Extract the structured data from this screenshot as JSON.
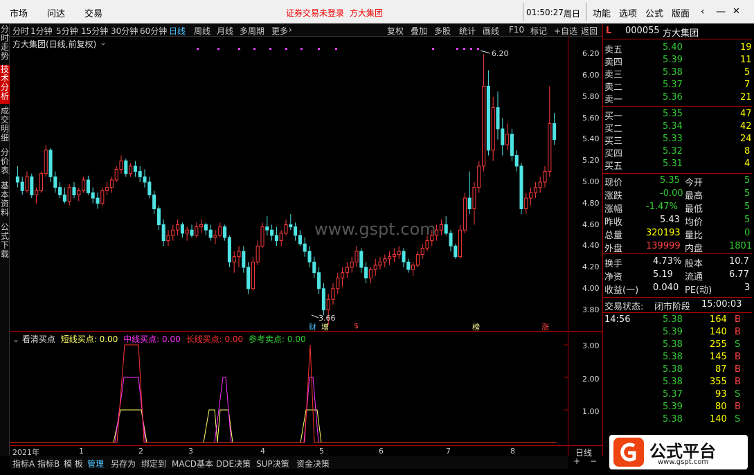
{
  "topbar": {
    "menu": [
      "市场",
      "问达",
      "交易"
    ],
    "warning": "证券交易未登录",
    "broker": "方大集团",
    "time": "01:50:27",
    "weekday": "周日",
    "right_menu": [
      "功能",
      "选项",
      "公式",
      "版面"
    ]
  },
  "toolbar": {
    "periods": [
      "分时",
      "1分钟",
      "5分钟",
      "15分钟",
      "30分钟",
      "60分钟",
      "日线",
      "周线",
      "月线",
      "多周期",
      "更多"
    ],
    "active_period": "日线",
    "actions": [
      "复权",
      "叠加",
      "多股",
      "统计",
      "画线",
      "F10",
      "标记",
      "+自选",
      "返回"
    ]
  },
  "lefttabs": [
    "分时走势",
    "技术分析",
    "成交明细",
    "分价表",
    "基本资料",
    "公式下载"
  ],
  "chart": {
    "title": "方大集团(日线,前复权)",
    "high_label": "6.20",
    "low_label": "3.66",
    "watermark": "www.gspt.com",
    "markers": [
      "财",
      "增",
      "$",
      "榜",
      "涨"
    ]
  },
  "chart_data": {
    "type": "candlestick",
    "ylim": [
      3.7,
      6.3
    ],
    "yticks": [
      3.8,
      4.0,
      4.2,
      4.4,
      4.6,
      4.8,
      5.0,
      5.2,
      5.4,
      5.6,
      5.8,
      6.0,
      6.2
    ],
    "ohlc": [
      [
        5.05,
        5.15,
        4.95,
        5.0
      ],
      [
        5.0,
        5.05,
        4.88,
        4.92
      ],
      [
        4.92,
        5.1,
        4.9,
        5.05
      ],
      [
        5.05,
        5.08,
        4.85,
        4.88
      ],
      [
        4.88,
        4.95,
        4.8,
        4.92
      ],
      [
        4.92,
        5.1,
        4.9,
        5.08
      ],
      [
        5.08,
        5.35,
        5.05,
        5.3
      ],
      [
        5.3,
        5.32,
        5.0,
        5.05
      ],
      [
        5.05,
        5.1,
        4.9,
        4.95
      ],
      [
        4.95,
        5.0,
        4.85,
        4.88
      ],
      [
        4.88,
        4.95,
        4.8,
        4.82
      ],
      [
        4.82,
        4.98,
        4.78,
        4.95
      ],
      [
        4.95,
        5.0,
        4.85,
        4.88
      ],
      [
        4.88,
        4.95,
        4.82,
        4.92
      ],
      [
        4.92,
        5.05,
        4.9,
        5.02
      ],
      [
        5.02,
        5.06,
        4.88,
        4.9
      ],
      [
        4.9,
        4.95,
        4.8,
        4.85
      ],
      [
        4.85,
        4.9,
        4.75,
        4.8
      ],
      [
        4.8,
        4.95,
        4.78,
        4.92
      ],
      [
        4.92,
        5.0,
        4.88,
        4.95
      ],
      [
        4.95,
        5.05,
        4.9,
        5.02
      ],
      [
        5.02,
        5.15,
        5.0,
        5.12
      ],
      [
        5.12,
        5.25,
        5.08,
        5.2
      ],
      [
        5.2,
        5.22,
        5.05,
        5.08
      ],
      [
        5.08,
        5.18,
        5.05,
        5.15
      ],
      [
        5.15,
        5.2,
        5.05,
        5.1
      ],
      [
        5.1,
        5.15,
        5.0,
        5.05
      ],
      [
        5.05,
        5.12,
        4.95,
        5.0
      ],
      [
        5.0,
        5.05,
        4.85,
        4.88
      ],
      [
        4.88,
        4.92,
        4.7,
        4.75
      ],
      [
        4.75,
        4.78,
        4.55,
        4.6
      ],
      [
        4.6,
        4.65,
        4.4,
        4.45
      ],
      [
        4.45,
        4.55,
        4.4,
        4.5
      ],
      [
        4.5,
        4.6,
        4.45,
        4.55
      ],
      [
        4.55,
        4.65,
        4.5,
        4.6
      ],
      [
        4.6,
        4.62,
        4.48,
        4.52
      ],
      [
        4.52,
        4.58,
        4.45,
        4.55
      ],
      [
        4.55,
        4.6,
        4.48,
        4.5
      ],
      [
        4.5,
        4.62,
        4.48,
        4.58
      ],
      [
        4.58,
        4.65,
        4.52,
        4.6
      ],
      [
        4.6,
        4.62,
        4.5,
        4.55
      ],
      [
        4.55,
        4.6,
        4.45,
        4.48
      ],
      [
        4.48,
        4.55,
        4.42,
        4.5
      ],
      [
        4.5,
        4.62,
        4.48,
        4.58
      ],
      [
        4.58,
        4.6,
        4.45,
        4.48
      ],
      [
        4.48,
        4.5,
        4.2,
        4.25
      ],
      [
        4.25,
        4.35,
        4.15,
        4.3
      ],
      [
        4.3,
        4.4,
        4.2,
        4.35
      ],
      [
        4.35,
        4.4,
        4.15,
        4.2
      ],
      [
        4.2,
        4.25,
        3.95,
        4.0
      ],
      [
        4.0,
        4.3,
        3.98,
        4.25
      ],
      [
        4.25,
        4.45,
        4.22,
        4.4
      ],
      [
        4.4,
        4.62,
        4.38,
        4.58
      ],
      [
        4.58,
        4.68,
        4.5,
        4.55
      ],
      [
        4.55,
        4.6,
        4.45,
        4.5
      ],
      [
        4.5,
        4.58,
        4.4,
        4.45
      ],
      [
        4.45,
        4.55,
        4.4,
        4.52
      ],
      [
        4.52,
        4.65,
        4.5,
        4.6
      ],
      [
        4.6,
        4.7,
        4.55,
        4.58
      ],
      [
        4.58,
        4.62,
        4.45,
        4.5
      ],
      [
        4.5,
        4.55,
        4.4,
        4.42
      ],
      [
        4.42,
        4.48,
        4.3,
        4.35
      ],
      [
        4.35,
        4.4,
        4.2,
        4.25
      ],
      [
        4.25,
        4.3,
        4.1,
        4.15
      ],
      [
        4.15,
        4.2,
        3.95,
        4.0
      ],
      [
        4.0,
        4.05,
        3.75,
        3.8
      ],
      [
        3.8,
        3.95,
        3.66,
        3.9
      ],
      [
        3.9,
        4.05,
        3.85,
        4.0
      ],
      [
        4.0,
        4.15,
        3.95,
        4.1
      ],
      [
        4.1,
        4.2,
        4.02,
        4.15
      ],
      [
        4.15,
        4.25,
        4.1,
        4.2
      ],
      [
        4.2,
        4.3,
        4.15,
        4.25
      ],
      [
        4.25,
        4.4,
        4.2,
        4.35
      ],
      [
        4.35,
        4.38,
        4.15,
        4.2
      ],
      [
        4.2,
        4.25,
        4.05,
        4.1
      ],
      [
        4.1,
        4.2,
        4.05,
        4.18
      ],
      [
        4.18,
        4.28,
        4.12,
        4.22
      ],
      [
        4.22,
        4.3,
        4.18,
        4.25
      ],
      [
        4.25,
        4.32,
        4.2,
        4.28
      ],
      [
        4.28,
        4.35,
        4.22,
        4.3
      ],
      [
        4.3,
        4.38,
        4.25,
        4.32
      ],
      [
        4.32,
        4.4,
        4.28,
        4.35
      ],
      [
        4.35,
        4.38,
        4.2,
        4.25
      ],
      [
        4.25,
        4.28,
        4.15,
        4.18
      ],
      [
        4.18,
        4.25,
        4.12,
        4.22
      ],
      [
        4.22,
        4.35,
        4.2,
        4.32
      ],
      [
        4.32,
        4.42,
        4.28,
        4.38
      ],
      [
        4.38,
        4.5,
        4.35,
        4.45
      ],
      [
        4.45,
        4.55,
        4.4,
        4.5
      ],
      [
        4.5,
        4.6,
        4.45,
        4.55
      ],
      [
        4.55,
        4.65,
        4.5,
        4.6
      ],
      [
        4.6,
        4.68,
        4.5,
        4.52
      ],
      [
        4.52,
        4.55,
        4.35,
        4.4
      ],
      [
        4.4,
        4.42,
        4.28,
        4.3
      ],
      [
        4.3,
        4.6,
        4.28,
        4.55
      ],
      [
        4.55,
        4.9,
        4.52,
        4.85
      ],
      [
        4.85,
        5.1,
        4.7,
        4.75
      ],
      [
        4.75,
        5.0,
        4.6,
        4.95
      ],
      [
        4.95,
        5.2,
        4.9,
        5.15
      ],
      [
        5.15,
        6.2,
        5.1,
        5.9
      ],
      [
        5.9,
        6.05,
        5.25,
        5.3
      ],
      [
        5.3,
        5.8,
        5.2,
        5.7
      ],
      [
        5.7,
        5.85,
        5.4,
        5.5
      ],
      [
        5.5,
        5.6,
        5.25,
        5.35
      ],
      [
        5.35,
        5.55,
        5.3,
        5.45
      ],
      [
        5.45,
        5.5,
        5.2,
        5.25
      ],
      [
        5.25,
        5.3,
        5.1,
        5.15
      ],
      [
        5.15,
        5.18,
        4.7,
        4.75
      ],
      [
        4.75,
        4.9,
        4.7,
        4.85
      ],
      [
        4.85,
        4.95,
        4.78,
        4.9
      ],
      [
        4.9,
        5.0,
        4.85,
        4.95
      ],
      [
        4.95,
        5.05,
        4.9,
        5.0
      ],
      [
        5.0,
        5.15,
        4.95,
        5.1
      ],
      [
        5.1,
        5.9,
        5.05,
        5.55
      ],
      [
        5.55,
        5.65,
        5.35,
        5.4
      ]
    ]
  },
  "sub": {
    "title": "看清买点",
    "legend": [
      {
        "name": "短线买点",
        "value": "0.00",
        "color": "#ffff66"
      },
      {
        "name": "中线买点",
        "value": "0.00",
        "color": "#ff33ff"
      },
      {
        "name": "长线买点",
        "value": "0.00",
        "color": "#ff3333"
      },
      {
        "name": "参考卖点",
        "value": "0.00",
        "color": "#33cc33"
      }
    ],
    "yticks": [
      "3.00",
      "2.00",
      "1.00"
    ]
  },
  "xaxis": {
    "labels": [
      "2021年",
      "1",
      "2",
      "3",
      "4",
      "5",
      "6",
      "7",
      "8"
    ],
    "period": "日线"
  },
  "bottomtabs": [
    "指标A",
    "指标B",
    "模 板",
    "管理",
    "另存为",
    "绑定到",
    "MACD基本",
    "DDE决策",
    "SUP决策",
    "资金决策"
  ],
  "rightpanel": {
    "code": "000055",
    "name": "方大集团",
    "sell": [
      {
        "label": "卖五",
        "price": "5.40",
        "vol": "19"
      },
      {
        "label": "卖四",
        "price": "5.39",
        "vol": "11"
      },
      {
        "label": "卖三",
        "price": "5.38",
        "vol": "5"
      },
      {
        "label": "卖二",
        "price": "5.37",
        "vol": "7"
      },
      {
        "label": "卖一",
        "price": "5.36",
        "vol": "21"
      }
    ],
    "buy": [
      {
        "label": "买一",
        "price": "5.35",
        "vol": "47"
      },
      {
        "label": "买二",
        "price": "5.34",
        "vol": "42"
      },
      {
        "label": "买三",
        "price": "5.33",
        "vol": "24"
      },
      {
        "label": "买四",
        "price": "5.32",
        "vol": "8"
      },
      {
        "label": "买五",
        "price": "5.31",
        "vol": "4"
      }
    ],
    "stats": [
      {
        "l1": "现价",
        "v1": "5.35",
        "c1": "green",
        "l2": "今开",
        "v2": "5"
      },
      {
        "l1": "涨跌",
        "v1": "-0.00",
        "c1": "green",
        "l2": "最高",
        "v2": "5"
      },
      {
        "l1": "涨幅",
        "v1": "-1.47%",
        "c1": "green",
        "l2": "最低",
        "v2": "5"
      },
      {
        "l1": "昨收",
        "v1": "5.43",
        "c1": "white",
        "l2": "均价",
        "v2": "5"
      },
      {
        "l1": "总量",
        "v1": "320193",
        "c1": "yellow",
        "l2": "量比",
        "v2": "0"
      },
      {
        "l1": "外盘",
        "v1": "139999",
        "c1": "red",
        "l2": "内盘",
        "v2": "1801"
      }
    ],
    "stats2": [
      {
        "l1": "换手",
        "v1": "4.73%",
        "l2": "股本",
        "v2": "10.7"
      },
      {
        "l1": "净资",
        "v1": "5.19",
        "l2": "流通",
        "v2": "6.77"
      },
      {
        "l1": "收益(一)",
        "v1": "0.040",
        "l2": "PE(动)",
        "v2": "3"
      }
    ],
    "status_label": "交易状态:",
    "status_value": "闭市阶段",
    "status_time": "15:00:03",
    "ticks": [
      {
        "time": "14:56",
        "price": "5.38",
        "vol": "164",
        "side": "B"
      },
      {
        "time": "",
        "price": "5.39",
        "vol": "140",
        "side": "B"
      },
      {
        "time": "",
        "price": "5.38",
        "vol": "255",
        "side": "S"
      },
      {
        "time": "",
        "price": "5.38",
        "vol": "145",
        "side": "B"
      },
      {
        "time": "",
        "price": "5.38",
        "vol": "87",
        "side": "B"
      },
      {
        "time": "",
        "price": "5.38",
        "vol": "355",
        "side": "B"
      },
      {
        "time": "",
        "price": "5.37",
        "vol": "93",
        "side": "S"
      },
      {
        "time": "",
        "price": "5.39",
        "vol": "80",
        "side": "B"
      },
      {
        "time": "",
        "price": "5.38",
        "vol": "140",
        "side": "S"
      }
    ]
  },
  "logo": {
    "text": "公式平台",
    "url": "www.gspt.com"
  }
}
